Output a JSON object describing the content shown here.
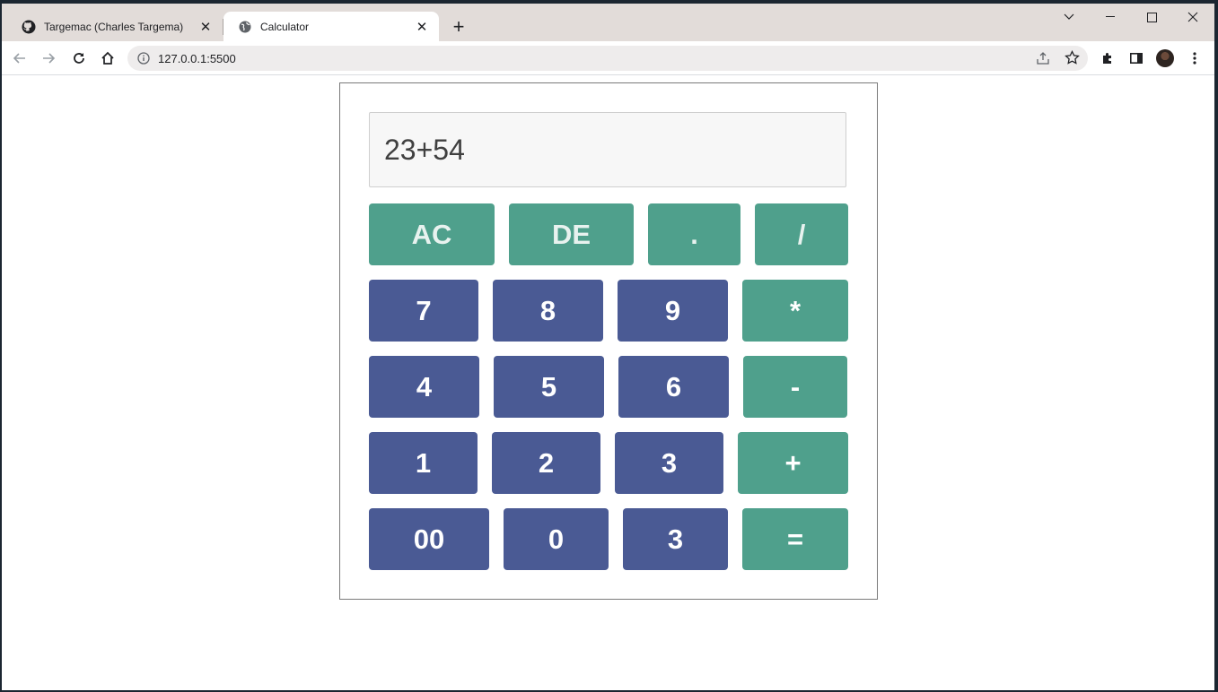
{
  "browser": {
    "tabs": [
      {
        "title": "Targemac (Charles Targema)",
        "active": false,
        "icon": "github-icon"
      },
      {
        "title": "Calculator",
        "active": true,
        "icon": "globe-icon"
      }
    ],
    "address": "127.0.0.1:5500"
  },
  "calculator": {
    "display": "23+54",
    "keys": {
      "ac": "AC",
      "de": "DE",
      "dot": ".",
      "divide": "/",
      "seven": "7",
      "eight": "8",
      "nine": "9",
      "multiply": "*",
      "four": "4",
      "five": "5",
      "six": "6",
      "minus": "-",
      "one": "1",
      "two": "2",
      "three": "3",
      "plus": "+",
      "doublezero": "00",
      "zero": "0",
      "three_b": "3",
      "equals": "="
    }
  },
  "colors": {
    "operator": "#4fa08c",
    "number": "#4a5a94"
  }
}
